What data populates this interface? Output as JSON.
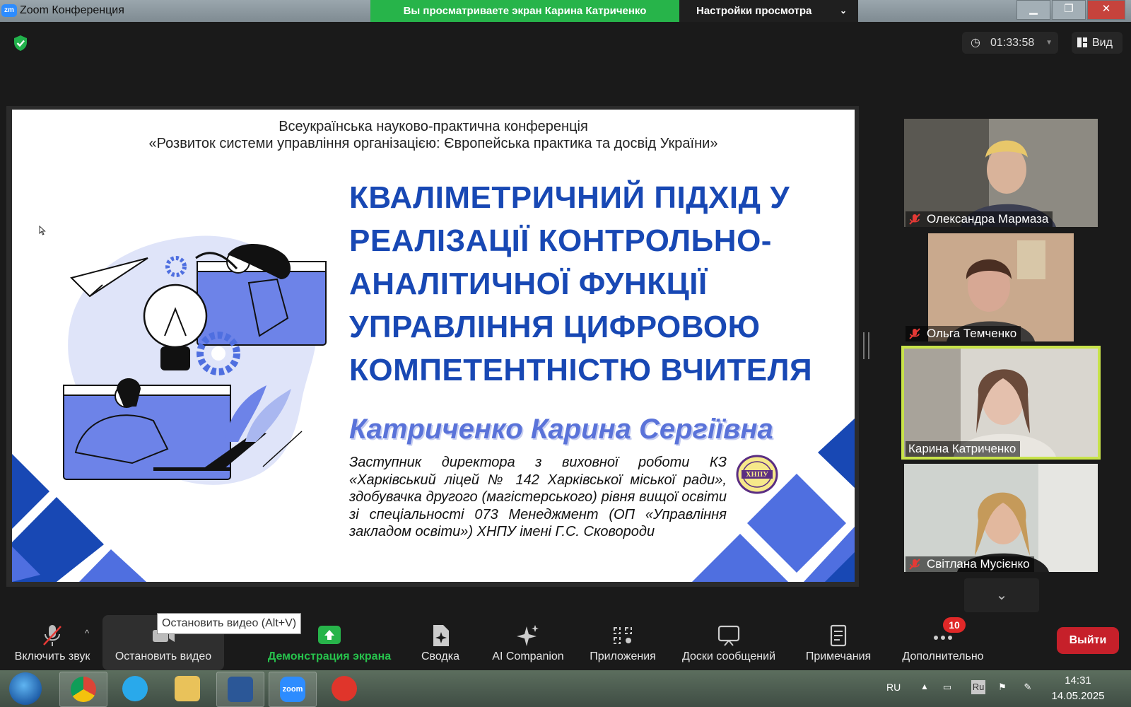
{
  "window": {
    "app_icon_label": "zm",
    "title": "Zoom Конференция",
    "share_banner": "Вы просматриваете экран Карина Катриченко",
    "view_settings": "Настройки просмотра",
    "controls": {
      "minimize": "▁",
      "restore": "❐",
      "close": "✕"
    }
  },
  "meeting_header": {
    "timer": "01:33:58",
    "view_label": "Вид"
  },
  "slide": {
    "conference_line1": "Всеукраїнська науково-практична конференція",
    "conference_line2": "«Розвиток системи управління організацією: Європейська практика та досвід України»",
    "title_lines": [
      "КВАЛІМЕТРИЧНИЙ ПІДХІД У",
      "РЕАЛІЗАЦІЇ КОНТРОЛЬНО-",
      "АНАЛІТИЧНОЇ ФУНКЦІЇ",
      "УПРАВЛІННЯ ЦИФРОВОЮ",
      "КОМПЕТЕНТНІСТЮ ВЧИТЕЛЯ"
    ],
    "author": "Катриченко Карина Сергіївна",
    "affiliation": "Заступник директора з виховної роботи КЗ «Харківський ліцей № 142 Харківської міської ради», здобувачка другого (магістерського) рівня вищої освіти зі спеціальності 073 Менеджмент (ОП «Управління закладом освіти») ХНПУ імені Г.С. Сковороди",
    "emblem_text": "ХНПУ"
  },
  "participants": [
    {
      "name": "Олександра Мармаза",
      "muted": true,
      "active": false
    },
    {
      "name": "Ольга Темченко",
      "muted": true,
      "active": false
    },
    {
      "name": "Карина Катриченко",
      "muted": false,
      "active": true
    },
    {
      "name": "Світлана Мусієнко",
      "muted": true,
      "active": false
    }
  ],
  "more_tiles_icon": "chevron-down-icon",
  "toolbar": {
    "unmute": "Включить звук",
    "stop_video": "Остановить видео",
    "stop_video_tooltip": "Остановить видео (Alt+V)",
    "share_screen": "Демонстрация экрана",
    "summary": "Сводка",
    "ai_companion": "AI Companion",
    "apps": "Приложения",
    "whiteboards": "Доски сообщений",
    "notes": "Примечания",
    "more": "Дополнительно",
    "more_badge": "10",
    "leave": "Выйти"
  },
  "colors": {
    "share_green": "#27b44a",
    "title_blue": "#1848b4",
    "author_blue": "#5a73d9",
    "active_speaker": "#c8e34a",
    "leave_red": "#c6202a",
    "badge_red": "#e02828"
  },
  "taskbar": {
    "apps": [
      "chrome",
      "telegram",
      "explorer",
      "word",
      "zoom",
      "wps"
    ],
    "zoom_label": "zoom",
    "language": "RU",
    "ime": "Ru",
    "time": "14:31",
    "date": "14.05.2025"
  }
}
